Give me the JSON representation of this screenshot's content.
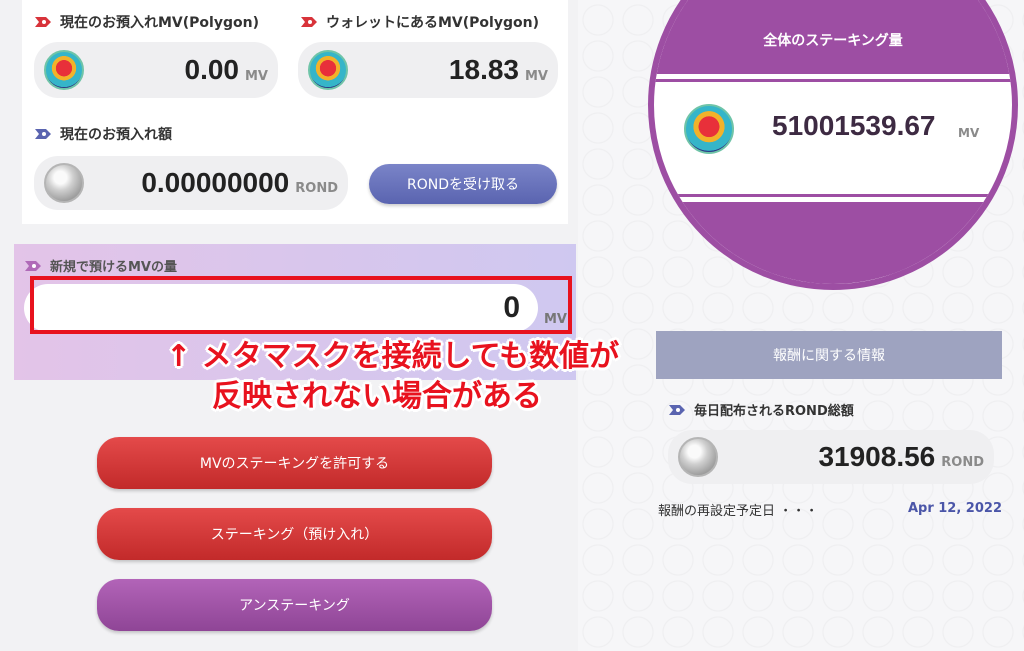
{
  "deposit": {
    "current_mv_label": "現在のお預入れMV(Polygon)",
    "current_mv_value": "0.00",
    "current_mv_unit": "MV",
    "wallet_mv_label": "ウォレットにあるMV(Polygon)",
    "wallet_mv_value": "18.83",
    "wallet_mv_unit": "MV",
    "current_amount_label": "現在のお預入れ額",
    "current_amount_value": "0.00000000",
    "current_amount_unit": "ROND",
    "receive_button": "RONDを受け取る"
  },
  "new_deposit": {
    "label": "新規で預けるMVの量",
    "input_value": "0",
    "unit": "MV",
    "partial_text": "く"
  },
  "annotation": {
    "line1": "↑  メタマスクを接続しても数値が",
    "line2": "反映されない場合がある"
  },
  "actions": {
    "approve_button": "MVのステーキングを許可する",
    "stake_button": "ステーキング（預け入れ）",
    "unstake_button": "アンステーキング"
  },
  "total_staking": {
    "title": "全体のステーキング量",
    "value": "51001539.67",
    "unit": "MV"
  },
  "rewards": {
    "header": "報酬に関する情報",
    "daily_label": "毎日配布されるROND総額",
    "daily_value": "31908.56",
    "daily_unit": "ROND",
    "reset_label": "報酬の再設定予定日 ・・・",
    "reset_date": "Apr 12, 2022"
  },
  "colors": {
    "accent_purple": "#9d4ea3",
    "button_red": "#d03434",
    "label_icon_red": "#d8333a",
    "label_icon_blue": "#5a64b0",
    "date_blue": "#4a55a8"
  }
}
